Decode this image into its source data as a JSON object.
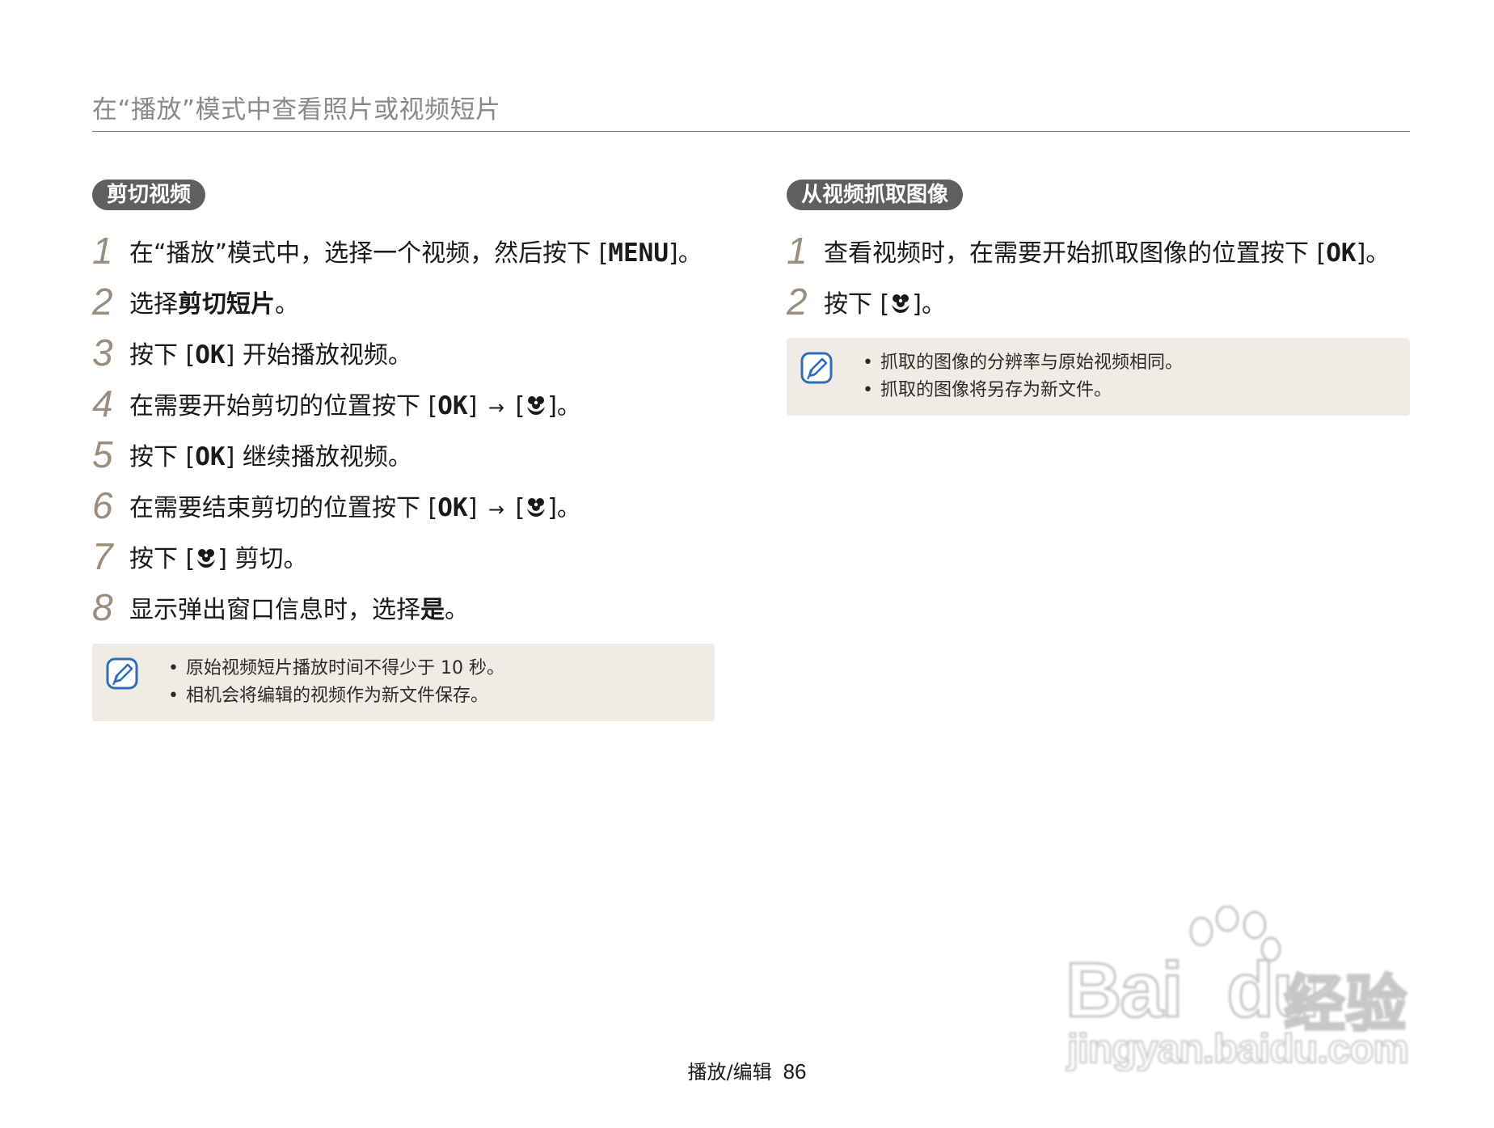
{
  "header": {
    "title": "在“播放”模式中查看照片或视频短片"
  },
  "left": {
    "section_title": "剪切视频",
    "steps": [
      {
        "num": "1",
        "pre": "在“播放”模式中，选择一个视频，然后按下 [",
        "key": "MENU",
        "post": "]。"
      },
      {
        "num": "2",
        "pre": "选择",
        "bold": "剪切短片",
        "post": "。"
      },
      {
        "num": "3",
        "pre": "按下 [",
        "key": "OK",
        "post": "] 开始播放视频。"
      },
      {
        "num": "4",
        "pre": "在需要开始剪切的位置按下 [",
        "key": "OK",
        "mid": "] ",
        "arrow": "→",
        "mid2": " [",
        "post": "]。"
      },
      {
        "num": "5",
        "pre": "按下 [",
        "key": "OK",
        "post": "] 继续播放视频。"
      },
      {
        "num": "6",
        "pre": "在需要结束剪切的位置按下 [",
        "key": "OK",
        "mid": "] ",
        "arrow": "→",
        "mid2": " [",
        "post": "]。"
      },
      {
        "num": "7",
        "pre": "按下 [",
        "post": "] 剪切。"
      },
      {
        "num": "8",
        "pre": "显示弹出窗口信息时，选择",
        "bold": "是",
        "post": "。"
      }
    ],
    "notes": [
      "原始视频短片播放时间不得少于 10 秒。",
      "相机会将编辑的视频作为新文件保存。"
    ]
  },
  "right": {
    "section_title": "从视频抓取图像",
    "steps": [
      {
        "num": "1",
        "pre": "查看视频时，在需要开始抓取图像的位置按下 [",
        "key": "OK",
        "post": "]。"
      },
      {
        "num": "2",
        "pre": "按下 [",
        "post": "]。"
      }
    ],
    "notes": [
      "抓取的图像的分辨率与原始视频相同。",
      "抓取的图像将另存为新文件。"
    ]
  },
  "footer": {
    "section": "播放/编辑",
    "page": "86"
  },
  "watermark": {
    "logo_a": "Bai",
    "logo_b": "du",
    "logo_c": "经验",
    "url": "jingyan.baidu.com"
  },
  "colors": {
    "pill": "#5f5f5f",
    "note_bg": "#f0ebe5",
    "step_num": "#9a8e80",
    "icon_blue": "#2f6eb5"
  },
  "icons": {
    "macro": "macro-flower-icon",
    "note": "note-pencil-icon"
  }
}
